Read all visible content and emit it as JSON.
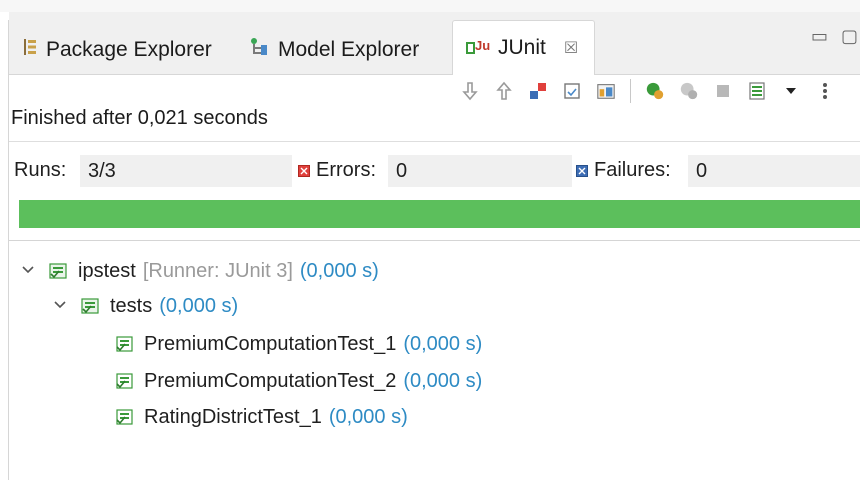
{
  "tabs": {
    "package_explorer": "Package Explorer",
    "model_explorer": "Model Explorer",
    "junit": "JUnit",
    "close_glyph": "☒"
  },
  "window_controls": {
    "minimize": "▭",
    "maximize": "▢"
  },
  "toolbar": {
    "icons": [
      "next-failure-icon",
      "previous-failure-icon",
      "show-failures-only-icon",
      "scroll-lock-icon",
      "history-icon",
      "rerun-icon",
      "rerun-failed-first-icon",
      "stop-icon",
      "test-run-history-icon",
      "view-menu-icon"
    ]
  },
  "status": {
    "finished": "Finished after 0,021 seconds"
  },
  "counters": {
    "runs_label": "Runs:",
    "runs_value": "3/3",
    "errors_label": "Errors:",
    "errors_value": "0",
    "failures_label": "Failures:",
    "failures_value": "0"
  },
  "progress": {
    "fraction": 1.0,
    "color": "#5cbf5c"
  },
  "tree": {
    "root": {
      "name": "ipstest",
      "runner": "[Runner: JUnit 3]",
      "time": "(0,000 s)"
    },
    "suite": {
      "name": "tests",
      "time": "(0,000 s)"
    },
    "tests": [
      {
        "name": "PremiumComputationTest_1",
        "time": "(0,000 s)"
      },
      {
        "name": "PremiumComputationTest_2",
        "time": "(0,000 s)"
      },
      {
        "name": "RatingDistrictTest_1",
        "time": "(0,000 s)"
      }
    ]
  },
  "colors": {
    "time_blue": "#2e8bc4",
    "success_green": "#5cbf5c",
    "error_red": "#e0403c",
    "failure_blue": "#3d6db5"
  }
}
